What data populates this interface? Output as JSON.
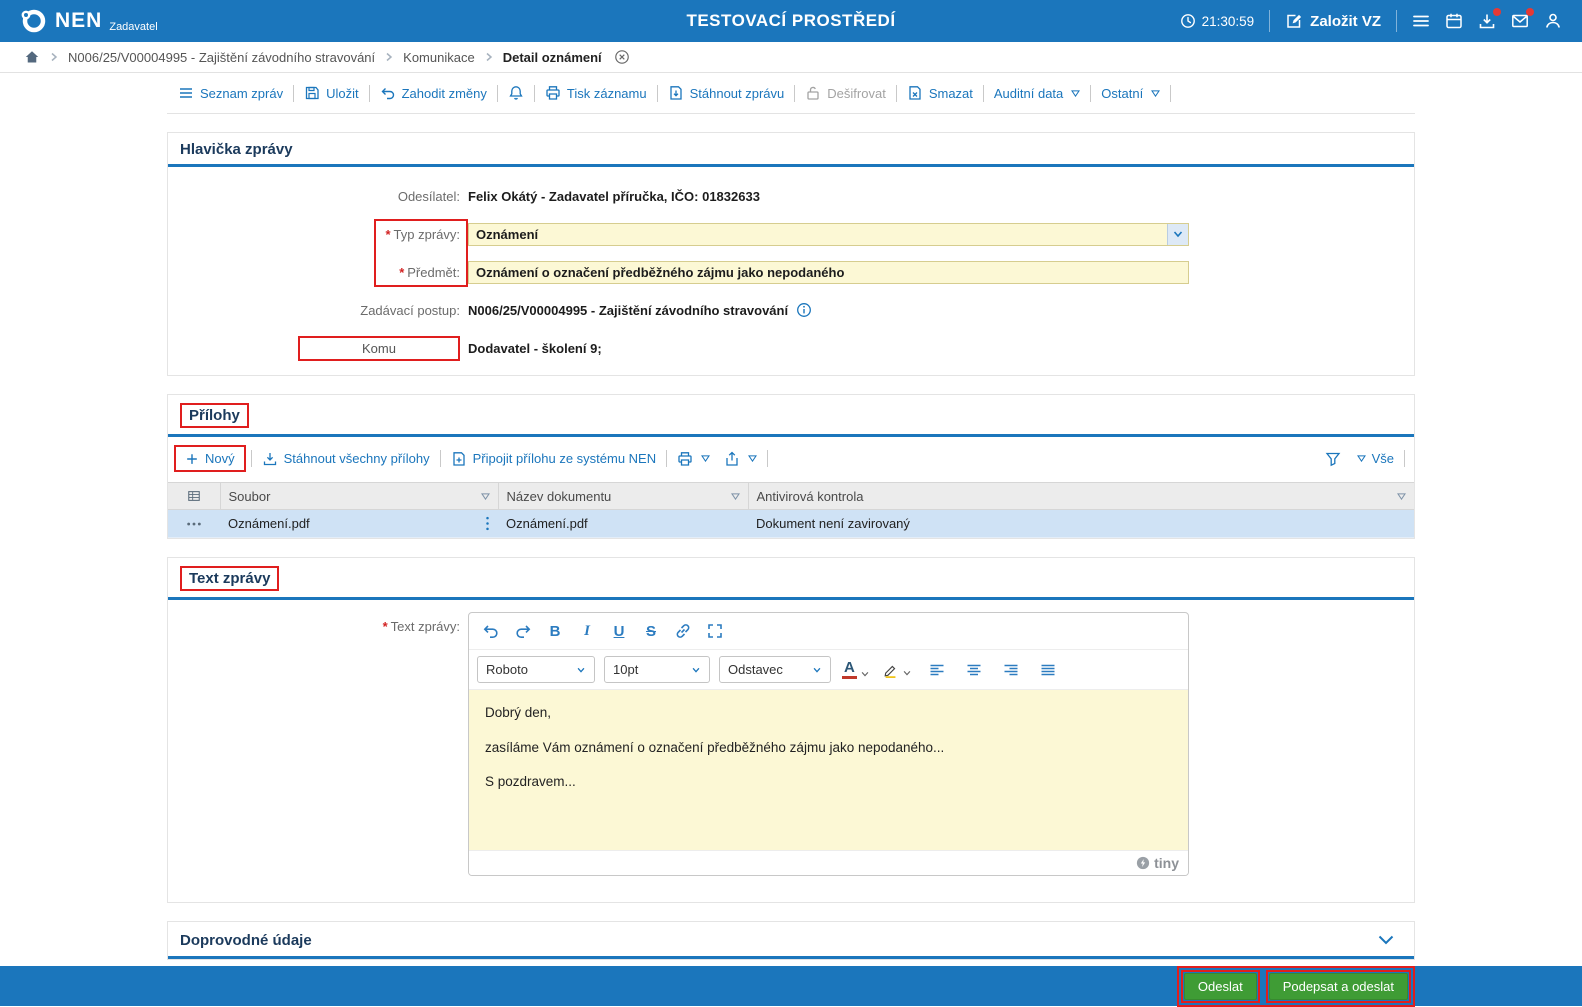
{
  "colors": {
    "primary_blue": "#1b76bc",
    "annotation_red": "#e01e1e",
    "field_yellow": "#fcf8d5",
    "button_green": "#3f9c35",
    "selected_row_blue": "#cfe2f5"
  },
  "topbar": {
    "brand": "NEN",
    "brand_sub": "Zadavatel",
    "env_title": "TESTOVACÍ PROSTŘEDÍ",
    "time": "21:30:59",
    "create_button": "Založit VZ"
  },
  "breadcrumb": {
    "items": [
      "N006/25/V00004995 - Zajištění závodního stravování",
      "Komunikace",
      "Detail oznámení"
    ]
  },
  "toolbar": {
    "list_messages": "Seznam zpráv",
    "save": "Uložit",
    "discard": "Zahodit změny",
    "print": "Tisk záznamu",
    "download_message": "Stáhnout zprávu",
    "decrypt": "Dešifrovat",
    "delete": "Smazat",
    "audit_data": "Auditní data",
    "other": "Ostatní"
  },
  "message_header": {
    "title": "Hlavička zprávy",
    "sender_label": "Odesílatel:",
    "sender_value": "Felix Okátý - Zadavatel příručka, IČO: 01832633",
    "type_label": "Typ zprávy:",
    "type_value": "Oznámení",
    "subject_label": "Předmět:",
    "subject_value": "Oznámení o označení předběžného zájmu jako nepodaného",
    "procedure_label": "Zadávací postup:",
    "procedure_value": "N006/25/V00004995 - Zajištění závodního stravování",
    "recipient_label": "Komu",
    "recipient_value": "Dodavatel - školení 9;"
  },
  "attachments": {
    "title": "Přílohy",
    "new": "Nový",
    "download_all": "Stáhnout všechny přílohy",
    "attach_from_nen": "Připojit přílohu ze systému NEN",
    "view_all": "Vše",
    "columns": [
      "Soubor",
      "Název dokumentu",
      "Antivirová kontrola"
    ],
    "rows": [
      {
        "file": "Oznámení.pdf",
        "document_name": "Oznámení.pdf",
        "antivirus": "Dokument není zavirovaný"
      }
    ]
  },
  "message_text": {
    "title": "Text zprávy",
    "label": "Text zprávy:",
    "editor": {
      "font": "Roboto",
      "size": "10pt",
      "block": "Odstavec",
      "glyphs": {
        "bold": "B",
        "italic": "I",
        "underline": "U",
        "strike": "S",
        "color": "A"
      },
      "paragraphs": [
        "Dobrý den,",
        "zasíláme Vám oznámení o označení předběžného zájmu jako nepodaného...",
        "S pozdravem..."
      ],
      "brand": "tiny"
    }
  },
  "additional": {
    "title": "Doprovodné údaje"
  },
  "footer": {
    "send": "Odeslat",
    "sign_and_send": "Podepsat a odeslat"
  }
}
